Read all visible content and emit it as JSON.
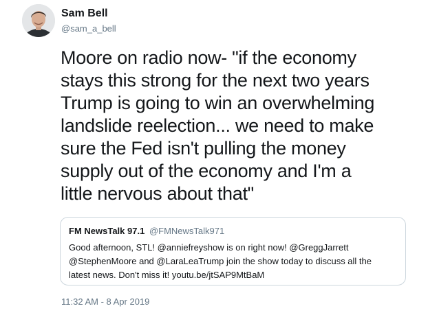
{
  "author": {
    "name": "Sam Bell",
    "handle": "@sam_a_bell"
  },
  "tweet": {
    "text_lines": [
      "Moore on radio now- \"if the economy",
      "stays this strong for the next two years",
      "Trump is going to win an overwhelming",
      "landslide reelection... we need to make",
      "sure the Fed isn't pulling the money",
      "supply out of the economy and I'm a",
      "little nervous about that\""
    ],
    "timestamp": "11:32 AM - 8 Apr 2019"
  },
  "quoted_tweet": {
    "name": "FM NewsTalk 97.1",
    "handle": "@FMNewsTalk971",
    "text_lines": [
      "Good afternoon, STL! @anniefreyshow is on right now! @GreggJarrett",
      "@StephenMoore and @LaraLeaTrump join the show today to discuss all the",
      "latest news. Don't miss it! youtu.be/jtSAP9MtBaM"
    ]
  },
  "colors": {
    "text_primary": "#14171a",
    "text_secondary": "#657786",
    "border": "#ccd6dd"
  },
  "icons": {
    "avatar": "user-avatar-photo"
  }
}
